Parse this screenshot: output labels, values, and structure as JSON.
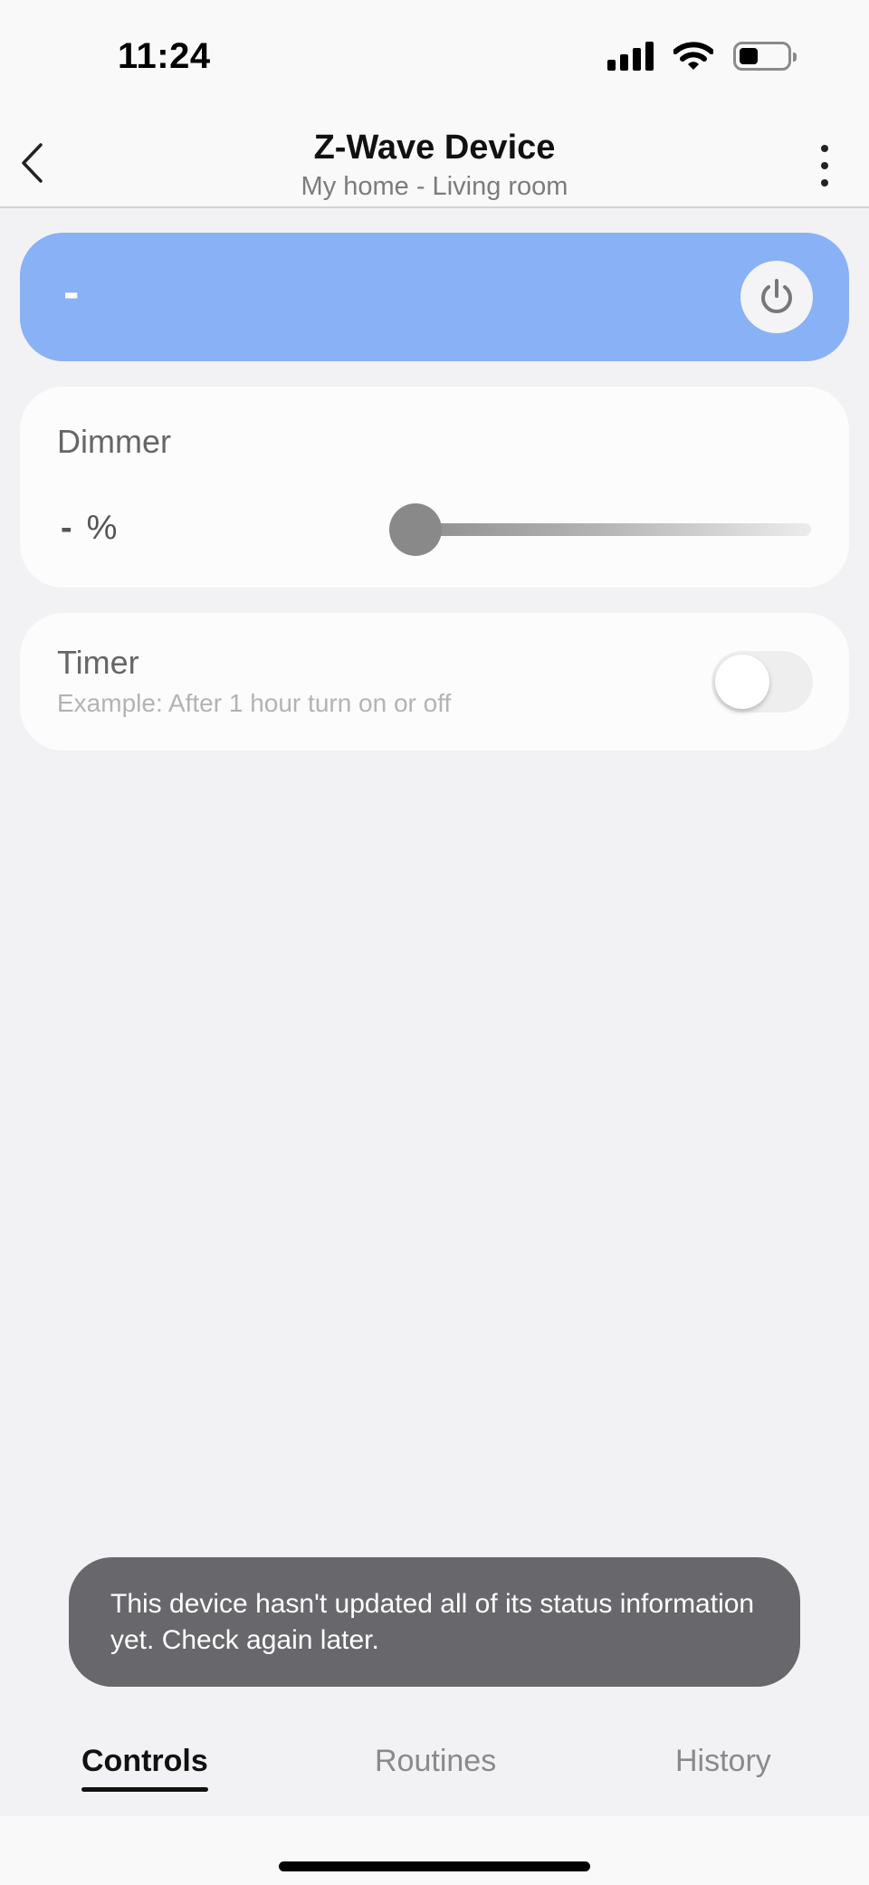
{
  "status_bar": {
    "time": "11:24"
  },
  "header": {
    "title": "Z-Wave Device",
    "subtitle": "My home - Living room"
  },
  "power": {
    "state": "-"
  },
  "dimmer": {
    "label": "Dimmer",
    "value": "-",
    "unit": "%"
  },
  "timer": {
    "label": "Timer",
    "hint": "Example: After 1 hour turn on or off",
    "enabled": false
  },
  "toast": {
    "message": "This device hasn't updated all of its status information yet. Check again later."
  },
  "tabs": [
    {
      "label": "Controls",
      "active": true
    },
    {
      "label": "Routines",
      "active": false
    },
    {
      "label": "History",
      "active": false
    }
  ],
  "colors": {
    "power_card": "#89b1f5",
    "background": "#f2f2f4",
    "toast": "#68686c"
  }
}
